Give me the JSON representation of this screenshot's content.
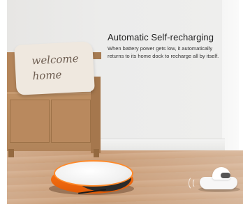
{
  "heading": "Automatic Self-recharging",
  "description": "When battery power gets low, it automatically returns to its home dock to recharge all by itself.",
  "pillow": {
    "line1": "welcome",
    "line2": "home"
  },
  "colors": {
    "robot_accent": "#ff7a1a",
    "floor": "#c99c77",
    "wall": "#ececeb"
  }
}
